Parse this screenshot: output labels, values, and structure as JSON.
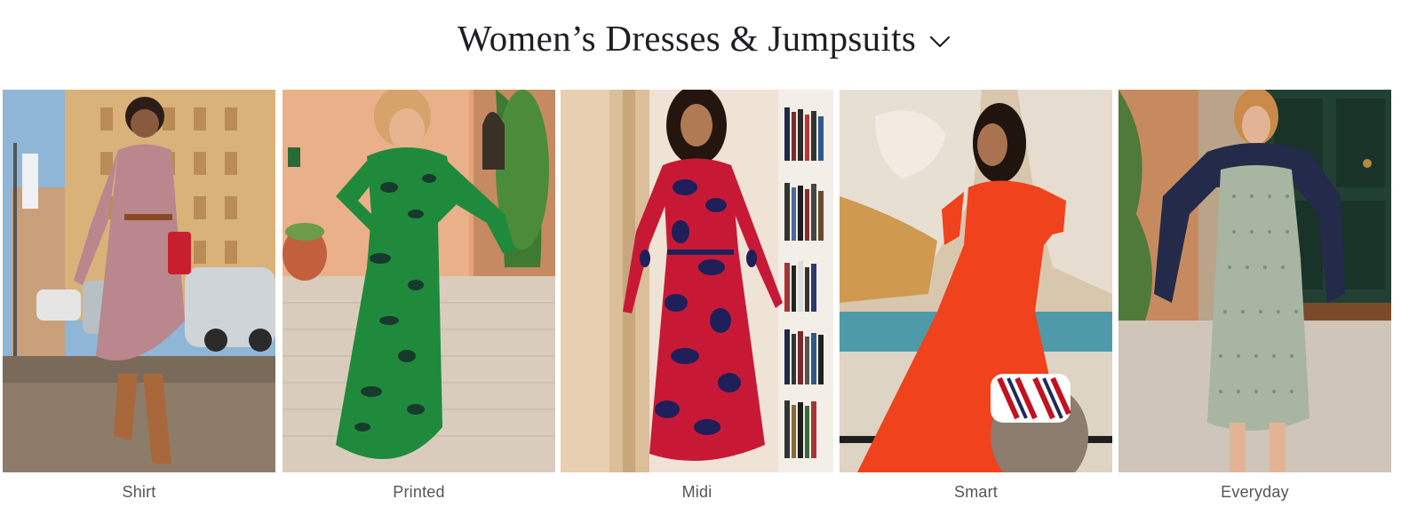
{
  "header": {
    "title": "Women’s Dresses & Jumpsuits",
    "dropdown_icon": "chevron-down-icon"
  },
  "categories": [
    {
      "label": "Shirt",
      "image_alt": "Model in a patterned shirt dress and brown boots walking on a city street",
      "dress_color": "#b9878d",
      "background_color": "#d7b27a"
    },
    {
      "label": "Printed",
      "image_alt": "Model in a green and navy printed midi dress on a cobbled street",
      "dress_color": "#1f8a3b",
      "background_color": "#e3a07a"
    },
    {
      "label": "Midi",
      "image_alt": "Model in a red and navy floral long-sleeve midi dress beside bookshelves",
      "dress_color": "#c71936",
      "background_color": "#ead8c8"
    },
    {
      "label": "Smart",
      "image_alt": "Model in an orange-red midi dress by a stone fountain holding a striped bag",
      "dress_color": "#f0421c",
      "background_color": "#d9c7ad"
    },
    {
      "label": "Everyday",
      "image_alt": "Model in a green geometric print shift dress with a navy jacket over her shoulders",
      "dress_color": "#a8b5a0",
      "background_color": "#b9a48a"
    }
  ]
}
